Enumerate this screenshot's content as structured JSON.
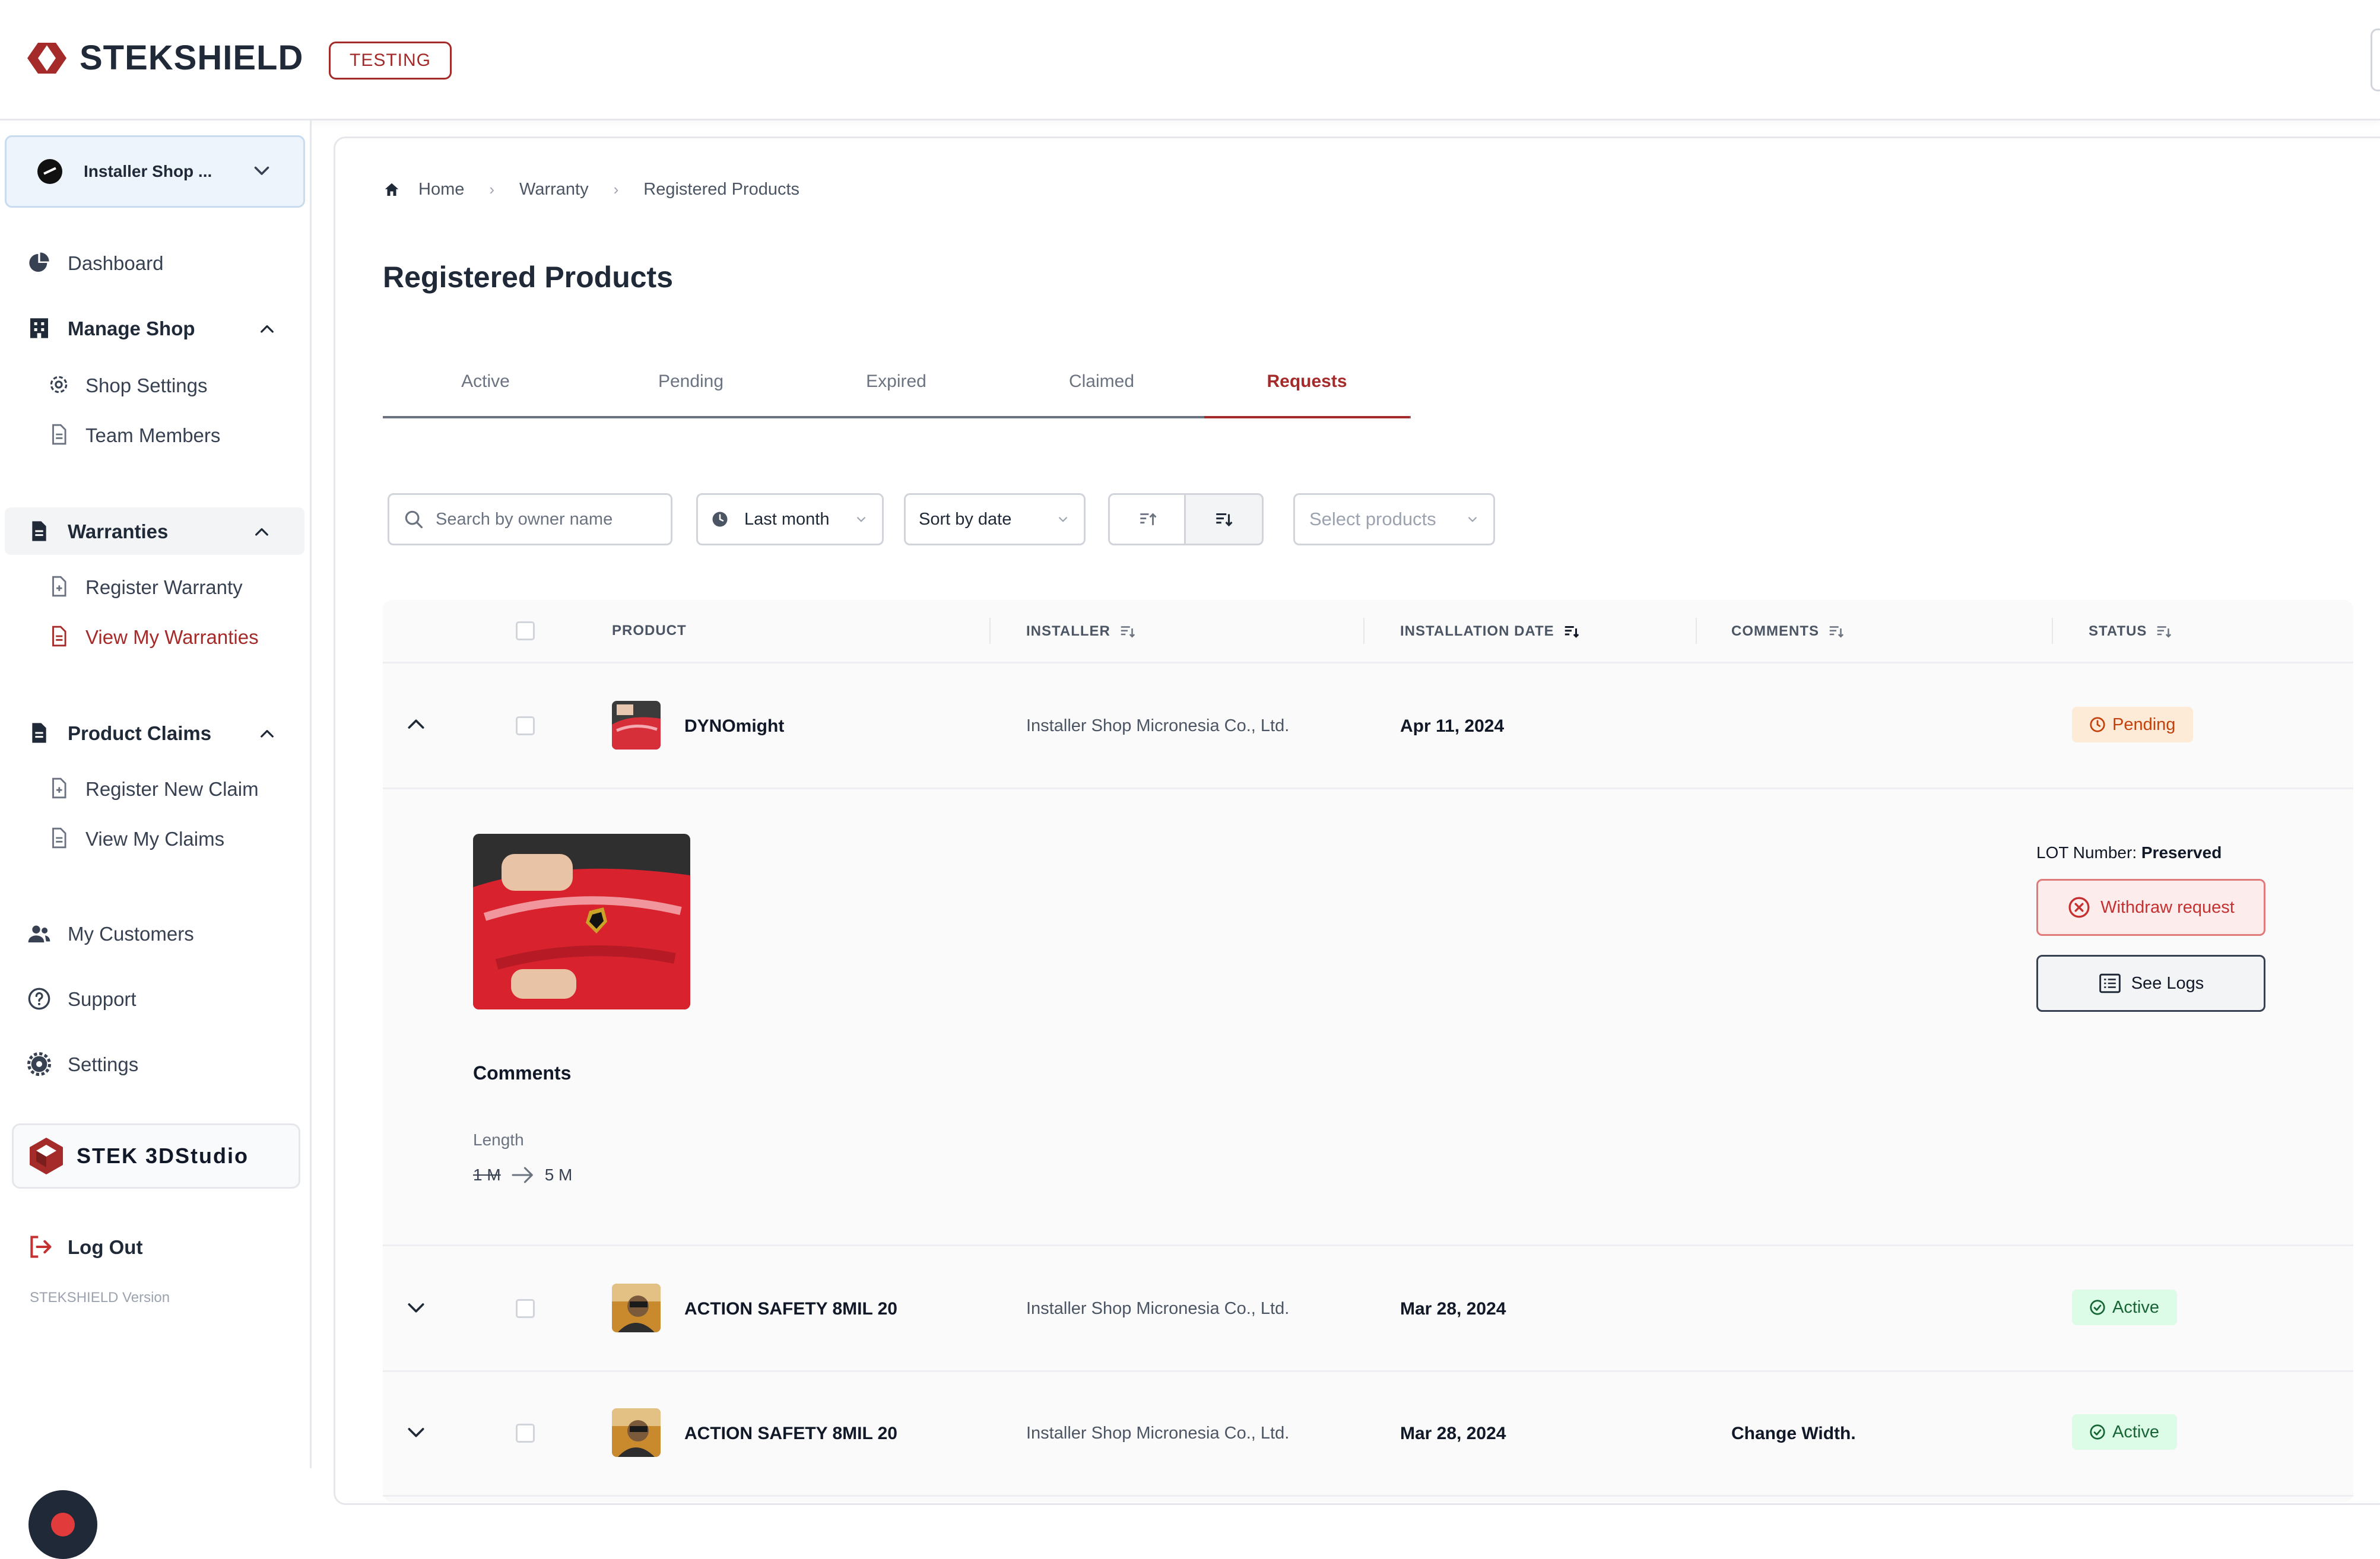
{
  "brand": {
    "name": "STEKSHIELD",
    "env_badge": "TESTING",
    "accent": "#a52a2a"
  },
  "sidebar": {
    "shop_selector": {
      "label": "Installer Shop ..."
    },
    "items": [
      {
        "label": "Dashboard",
        "icon": "pie-chart-icon"
      },
      {
        "label": "Manage Shop",
        "icon": "building-icon",
        "children": [
          {
            "label": "Shop Settings",
            "icon": "gear-icon"
          },
          {
            "label": "Team Members",
            "icon": "document-icon"
          }
        ]
      },
      {
        "label": "Warranties",
        "icon": "file-icon",
        "children": [
          {
            "label": "Register Warranty",
            "icon": "file-plus-icon"
          },
          {
            "label": "View My Warranties",
            "icon": "file-icon",
            "active": true
          }
        ]
      },
      {
        "label": "Product Claims",
        "icon": "file-icon",
        "children": [
          {
            "label": "Register New Claim",
            "icon": "file-plus-icon"
          },
          {
            "label": "View My Claims",
            "icon": "document-icon"
          }
        ]
      },
      {
        "label": "My Customers",
        "icon": "users-icon"
      },
      {
        "label": "Support",
        "icon": "help-circle-icon"
      },
      {
        "label": "Settings",
        "icon": "gear-icon"
      }
    ],
    "studio": {
      "label": "STEK 3DStudio"
    },
    "logout": {
      "label": "Log Out"
    },
    "version": "STEKSHIELD Version"
  },
  "breadcrumb": [
    "Home",
    "Warranty",
    "Registered Products"
  ],
  "page": {
    "title": "Registered Products"
  },
  "tabs": [
    {
      "label": "Active"
    },
    {
      "label": "Pending"
    },
    {
      "label": "Expired"
    },
    {
      "label": "Claimed"
    },
    {
      "label": "Requests",
      "active": true
    }
  ],
  "filters": {
    "search_placeholder": "Search by owner name",
    "date_range": "Last month",
    "sort": "Sort by date",
    "products_placeholder": "Select products"
  },
  "table": {
    "columns": [
      "PRODUCT",
      "INSTALLER",
      "INSTALLATION DATE",
      "COMMENTS",
      "STATUS"
    ],
    "rows": [
      {
        "product": "DYNOmight",
        "installer": "Installer Shop Micronesia Co., Ltd.",
        "date": "Apr 11, 2024",
        "comments": "",
        "status": "Pending",
        "expanded": true
      },
      {
        "product": "ACTION SAFETY 8MIL 20",
        "installer": "Installer Shop Micronesia Co., Ltd.",
        "date": "Mar 28, 2024",
        "comments": "",
        "status": "Active"
      },
      {
        "product": "ACTION SAFETY 8MIL 20",
        "installer": "Installer Shop Micronesia Co., Ltd.",
        "date": "Mar 28, 2024",
        "comments": "Change Width.",
        "status": "Active"
      }
    ],
    "detail": {
      "lot_label": "LOT Number:",
      "lot_value": "Preserved",
      "withdraw_label": "Withdraw request",
      "logs_label": "See Logs",
      "comments_title": "Comments",
      "length_label": "Length",
      "length_old": "1 M",
      "length_new": "5 M"
    }
  },
  "colors": {
    "pending_bg": "#fdebd8",
    "pending_text": "#c2410c",
    "active_bg": "#dcfce7",
    "active_text": "#166534"
  }
}
